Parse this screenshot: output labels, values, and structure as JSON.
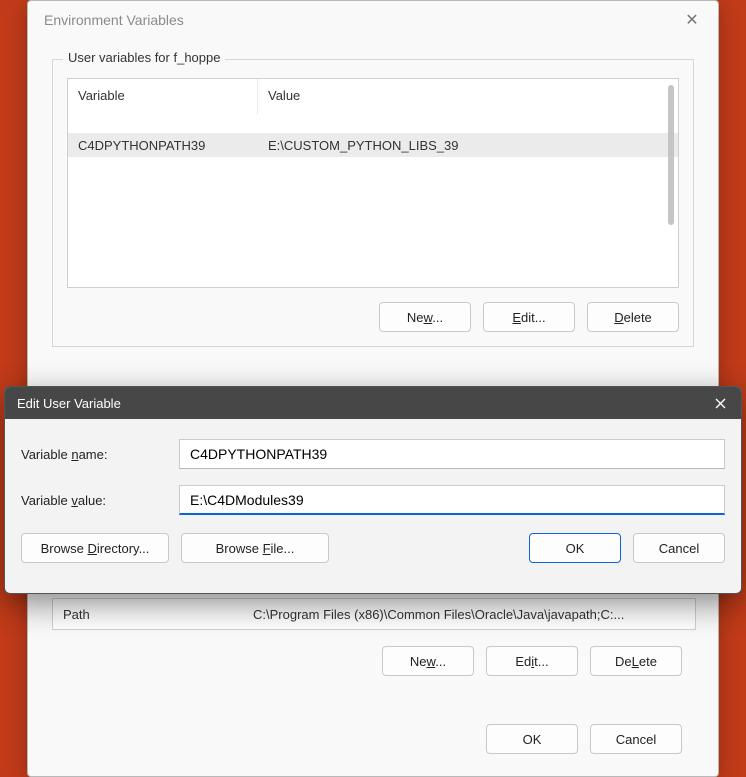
{
  "window": {
    "title": "Environment Variables",
    "close": "✕"
  },
  "userGroup": {
    "label": "User variables for f_hoppe",
    "columns": {
      "variable": "Variable",
      "value": "Value"
    },
    "rows": [
      {
        "variable": "C4DPYTHONPATH39",
        "value": "E:\\CUSTOM_PYTHON_LIBS_39"
      }
    ],
    "buttons": {
      "new": "New...",
      "edit": "Edit...",
      "delete": "Delete",
      "new_m": "w",
      "edit_m": "E",
      "delete_m": "D"
    }
  },
  "sysPeek": {
    "variable": "Path",
    "value": "C:\\Program Files (x86)\\Common Files\\Oracle\\Java\\javapath;C:..."
  },
  "sysButtons": {
    "new": "New...",
    "edit": "Edit...",
    "delete": "Delete",
    "new_m": "w",
    "edit_m": "i",
    "delete_m": "L"
  },
  "finalButtons": {
    "ok": "OK",
    "cancel": "Cancel"
  },
  "modal": {
    "title": "Edit User Variable",
    "close": "✕",
    "nameLabelPre": "Variable ",
    "nameLabelM": "n",
    "nameLabelPost": "ame:",
    "valueLabelPre": "Variable ",
    "valueLabelM": "v",
    "valueLabelPost": "alue:",
    "nameValue": "C4DPYTHONPATH39",
    "valueValue": "E:\\C4DModules39",
    "browseDirPre": "Browse ",
    "browseDirM": "D",
    "browseDirPost": "irectory...",
    "browseFilePre": "Browse ",
    "browseFileM": "F",
    "browseFilePost": "ile...",
    "ok": "OK",
    "cancel": "Cancel"
  }
}
